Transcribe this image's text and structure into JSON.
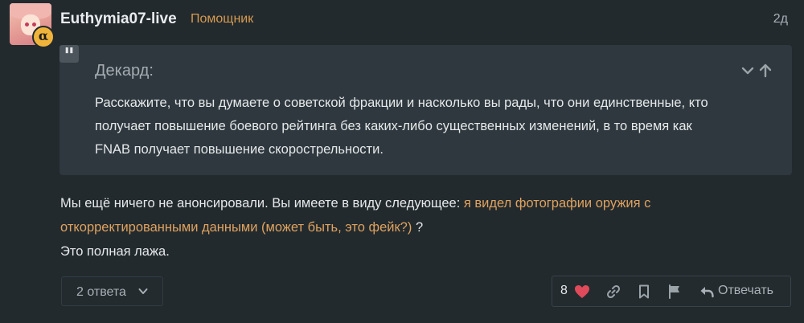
{
  "post": {
    "username": "Euthymia07-live",
    "role": "Помощник",
    "date": "2д",
    "badge": "α"
  },
  "quote": {
    "author": "Декард:",
    "lines": [
      "Расскажите, что вы думаете о советской фракции и насколько вы рады, что они единственные, кто",
      "получает повышение боевого рейтинга без каких-либо существенных изменений, в то время как",
      "FNAB получает повышение скорострельности."
    ]
  },
  "body": {
    "line1_text": "Мы ещё ничего не анонсировали. Вы имеете в виду следующее: ",
    "line1_link": "я видел фотографии оружия с",
    "line2_link": "откорректированными данными (может быть, это фейк?)",
    "line2_text": " ?",
    "line3": "Это полная лажа."
  },
  "footer": {
    "replies_label": "2 ответа",
    "like_count": "8",
    "reply_label": "Отвечать"
  },
  "colors": {
    "background": "#222a2e",
    "quote_bg": "#2e383e",
    "accent": "#d79a4f",
    "link": "#e0a25e",
    "like": "#e04a5a"
  },
  "icons": [
    "quote-icon",
    "chevron-down-icon",
    "arrow-up-icon",
    "heart-icon",
    "link-icon",
    "bookmark-icon",
    "flag-icon",
    "reply-icon"
  ]
}
